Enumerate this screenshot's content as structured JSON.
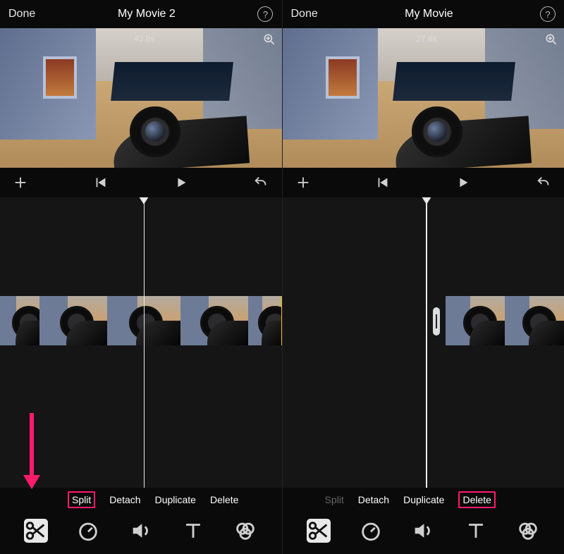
{
  "left": {
    "done": "Done",
    "title": "My Movie 2",
    "timestamp": "43.8s",
    "actions": {
      "split": "Split",
      "detach": "Detach",
      "duplicate": "Duplicate",
      "delete": "Delete"
    },
    "playhead_pct": 51,
    "clip": {
      "start_pct": 0,
      "end_pct": 100,
      "selected": true
    }
  },
  "right": {
    "done": "Done",
    "title": "My Movie",
    "timestamp": "27.8s",
    "actions": {
      "split": "Split",
      "detach": "Detach",
      "duplicate": "Duplicate",
      "delete": "Delete"
    },
    "playhead_pct": 51,
    "clip": {
      "start_pct": 58,
      "end_pct": 100,
      "selected": true
    }
  },
  "colors": {
    "accent": "#ff1a6e",
    "clip_select": "#f5c100"
  }
}
